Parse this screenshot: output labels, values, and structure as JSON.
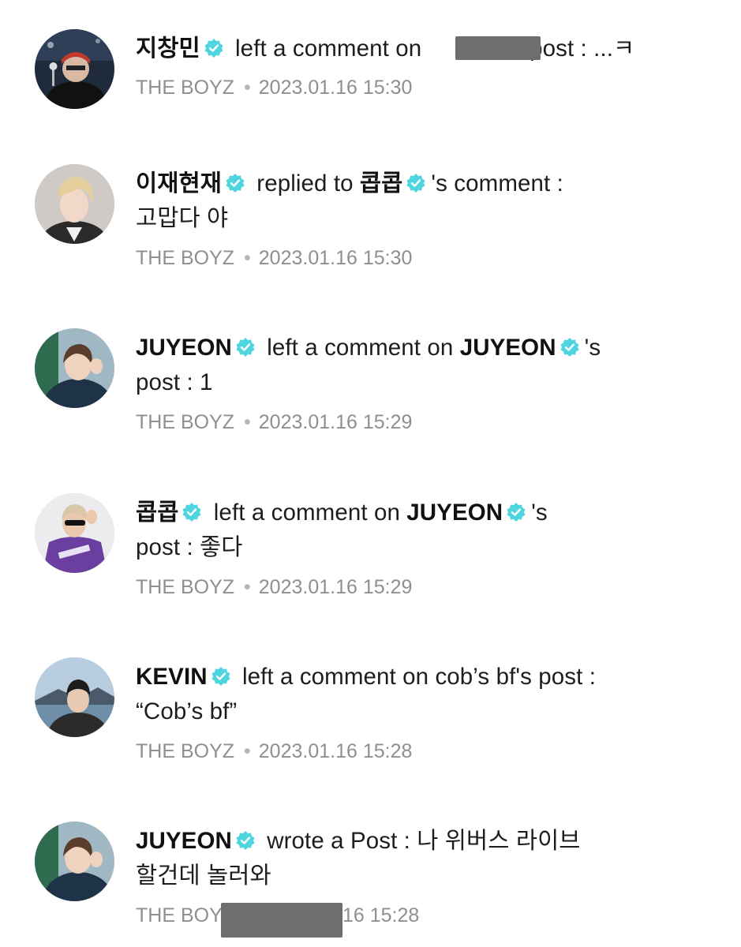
{
  "colors": {
    "verified": "#4fd5e0",
    "meta_text": "#8f8f8f",
    "redaction": "#6e6e6e"
  },
  "notifications": [
    {
      "actor": "지창민",
      "action": "left a comment on",
      "after_redaction": "'s post : ...ㅋ",
      "group": "THE BOYZ",
      "time": "2023.01.16 15:30",
      "avatar_icon": "user-avatar"
    },
    {
      "actor": "이재현재",
      "action": "replied to",
      "target": "콥콥",
      "suffix": "'s comment :",
      "line2": "고맙다 야",
      "group": "THE BOYZ",
      "time": "2023.01.16 15:30",
      "avatar_icon": "user-avatar"
    },
    {
      "actor": "JUYEON",
      "action": "left a comment on",
      "target": "JUYEON",
      "suffix": "'s",
      "line2": "post : 1",
      "group": "THE BOYZ",
      "time": "2023.01.16 15:29",
      "avatar_icon": "user-avatar"
    },
    {
      "actor": "콥콥",
      "action": "left a comment on",
      "target": "JUYEON",
      "suffix": "'s",
      "line2": "post : 좋다",
      "group": "THE BOYZ",
      "time": "2023.01.16 15:29",
      "avatar_icon": "user-avatar"
    },
    {
      "actor": "KEVIN",
      "action": "left a comment on cob’s bf's post :",
      "line2": "“Cob’s bf”",
      "group": "THE BOYZ",
      "time": "2023.01.16 15:28",
      "avatar_icon": "user-avatar"
    },
    {
      "actor": "JUYEON",
      "action": "wrote a Post : 나 위버스 라이브",
      "line2": "할건데 놀러와",
      "meta_left": "THE BOY",
      "meta_right": "16 15:28",
      "avatar_icon": "user-avatar"
    }
  ]
}
